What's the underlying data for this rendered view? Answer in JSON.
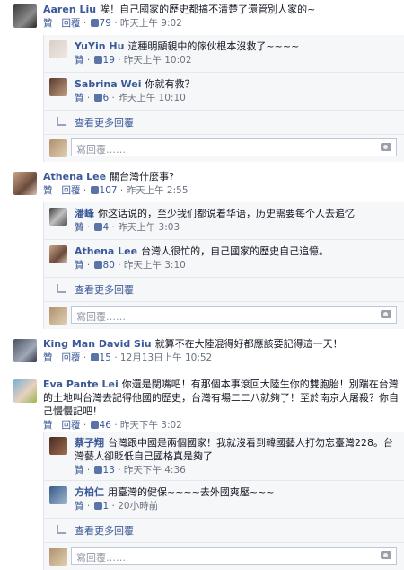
{
  "comments": [
    {
      "name": "Aaren Liu",
      "text": "唉！自己國家的歷史都搞不清楚了還管別人家的~",
      "like": "贊",
      "reply": "回覆",
      "likes": "79",
      "time": "昨天上午 9:02",
      "replies": [
        {
          "name": "YuYin Hu",
          "text": "這種明顯親中的傢伙根本沒救了~~~~",
          "like": "贊",
          "likes": "19",
          "time": "昨天上午 10:02"
        },
        {
          "name": "Sabrina Wei",
          "text": "你就有救？",
          "like": "贊",
          "likes": "6",
          "time": "昨天上午 10:10"
        }
      ],
      "more": "查看更多回覆",
      "write_placeholder": "寫回覆……"
    },
    {
      "name": "Athena Lee",
      "text": "關台灣什麼事?",
      "like": "贊",
      "reply": "回覆",
      "likes": "107",
      "time": "昨天上午 2:55",
      "replies": [
        {
          "name": "潘峰",
          "text": "你这话说的，至少我们都说着华语，历史需要每个人去追忆",
          "like": "贊",
          "likes": "4",
          "time": "昨天上午 3:03"
        },
        {
          "name": "Athena Lee",
          "text": "台灣人很忙的，自己國家的歷史自己追憶。",
          "like": "贊",
          "likes": "80",
          "time": "昨天上午 3:10"
        }
      ],
      "more": "查看更多回覆",
      "write_placeholder": "寫回覆……"
    },
    {
      "name": "King Man David Siu",
      "text": "就算不在大陸混得好都應該要記得這一天！",
      "like": "贊",
      "reply": "回覆",
      "likes": "15",
      "time": "12月13日上午 10:52"
    },
    {
      "name": "Eva Pante Lei",
      "text": "你還是閉嘴吧！有那個本事滾回大陸生你的雙胞胎！別踹在台灣的土地叫台灣去記得他國的歷史，台灣有場二二八就夠了！至於南京大屠殺？你自己慢慢記吧！",
      "like": "贊",
      "reply": "回覆",
      "likes": "46",
      "time": "昨天下午 3:02",
      "replies": [
        {
          "name": "蔡子翔",
          "text": "台灣跟中國是兩個國家！我就沒看到韓國藝人打勿忘臺灣228。台灣藝人卻貶低自己國格真是夠了",
          "like": "贊",
          "likes": "13",
          "time": "昨天下午 4:36"
        },
        {
          "name": "方柏仁",
          "text": "用臺灣的健保~~~~去外國爽壓~~~",
          "like": "贊",
          "likes": "1",
          "time": "20小時前"
        }
      ],
      "more": "查看更多回覆",
      "write_placeholder": "寫回覆……"
    }
  ]
}
